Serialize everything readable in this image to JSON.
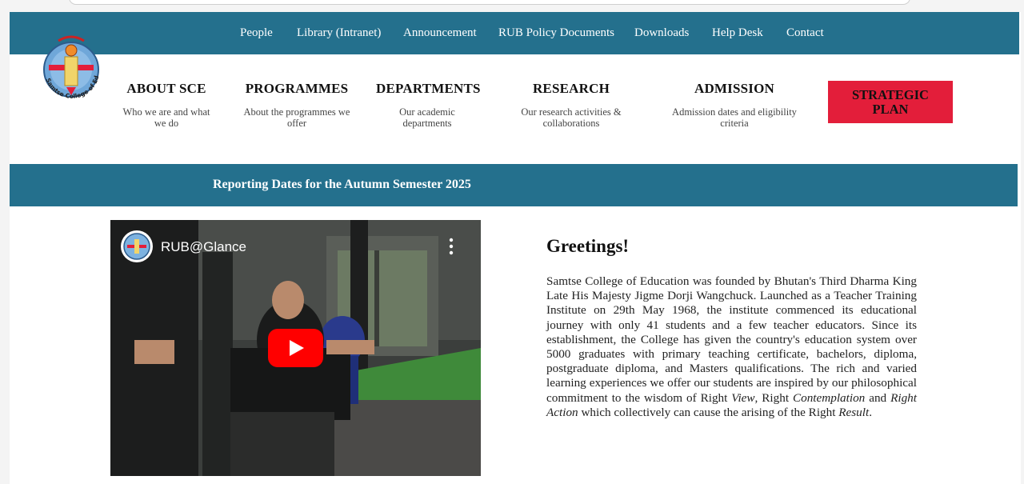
{
  "top_nav": {
    "items": [
      "People",
      "Library (Intranet)",
      "Announcement",
      "RUB Policy Documents",
      "Downloads",
      "Help Desk",
      "Contact"
    ]
  },
  "logo": {
    "alt": "Samtse College of Education",
    "ring_text": "Samtse College of Education"
  },
  "menu": {
    "items": [
      {
        "title": "ABOUT SCE",
        "subtitle": "Who we are and what we do"
      },
      {
        "title": "PROGRAMMES",
        "subtitle": "About the programmes we offer"
      },
      {
        "title": "DEPARTMENTS",
        "subtitle": "Our academic departments"
      },
      {
        "title": "RESEARCH",
        "subtitle": "Our research activities & collaborations"
      },
      {
        "title": "ADMISSION",
        "subtitle": "Admission dates and eligibility criteria"
      }
    ],
    "strategic_plan": "STRATEGIC PLAN"
  },
  "banner": {
    "text": "Reporting Dates for the Autumn Semester 2025"
  },
  "video": {
    "title": "RUB@Glance",
    "play_icon": "play-icon",
    "more_icon": "more-vert-icon"
  },
  "greetings": {
    "title": "Greetings!",
    "p1": "Samtse College of Education was founded by Bhutan's Third Dharma King Late His Majesty Jigme Dorji Wangchuck. Launched as a Teacher Training Institute on 29th May 1968, the institute commenced its educational journey with only 41 students and a few teacher educators. Since its establishment, the College has given the country's education system over 5000 graduates with primary teaching certificate, bachelors, diploma, postgraduate diploma, and Masters qualifications. The rich and varied learning experiences we offer our students are inspired by our philosophical commitment to the wisdom of Right ",
    "view": "View",
    "p2": ", Right ",
    "contemplation": "Contemplation",
    "p3": " and ",
    "right_action": "Right Action",
    "p4": " which collectively can cause the arising of the Right ",
    "result": "Result",
    "p5": "."
  },
  "colors": {
    "nav_bg": "#24708d",
    "accent_red": "#e31e3a"
  }
}
